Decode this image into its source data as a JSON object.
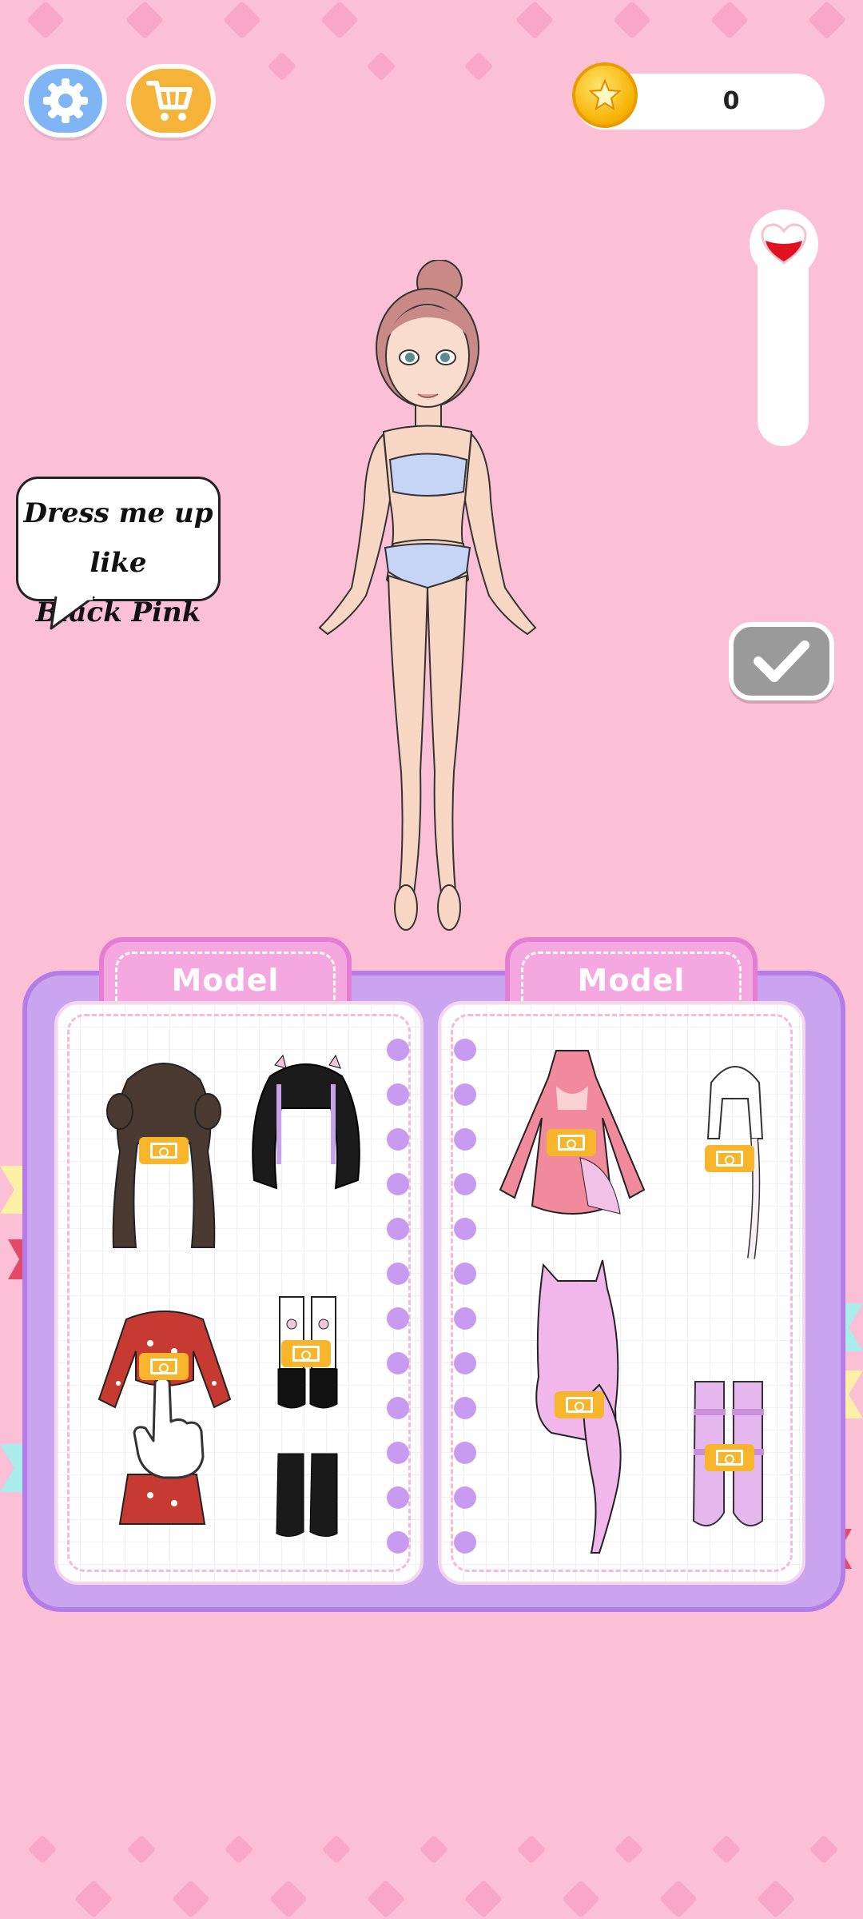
{
  "header": {
    "settings_icon": "gear-icon",
    "shop_icon": "cart-icon",
    "coin_count": "0",
    "settings_color": "#7fb5f4",
    "shop_color": "#f6b33a"
  },
  "speech_bubble": {
    "line1": "Dress me up like",
    "line2": "Black Pink"
  },
  "tabs": {
    "left": "Model",
    "right": "Model"
  },
  "confirm_icon": "check-icon",
  "heart_icon": "heart-icon",
  "ad_icon": "video-ad-icon",
  "items_left": [
    {
      "name": "hair-twin-braids"
    },
    {
      "name": "hair-black-bows"
    },
    {
      "name": "top-red-bandana"
    },
    {
      "name": "socks-bows"
    },
    {
      "name": "skirt-red-bandana"
    },
    {
      "name": "boots-black"
    }
  ],
  "items_right": [
    {
      "name": "dress-pink-cutout"
    },
    {
      "name": "hair-white-braid"
    },
    {
      "name": "dress-lilac-ruffle"
    },
    {
      "name": "boots-lilac-platform"
    }
  ]
}
